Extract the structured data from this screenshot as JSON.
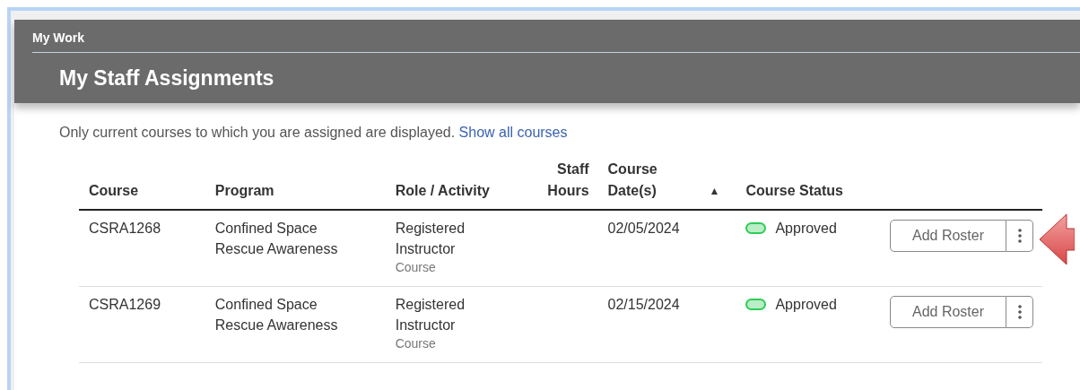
{
  "breadcrumb": "My Work",
  "title": "My Staff Assignments",
  "notice": {
    "text": "Only current courses to which you are assigned are displayed.",
    "link": "Show all courses"
  },
  "table": {
    "columns": [
      {
        "label": "Course"
      },
      {
        "label": "Program"
      },
      {
        "label": "Role / Activity"
      },
      {
        "label": "Staff Hours"
      },
      {
        "label": "Course Date(s)",
        "sort": "▲"
      },
      {
        "label": "Course Status"
      }
    ],
    "rows": [
      {
        "course": "CSRA1268",
        "program": "Confined Space Rescue Awareness",
        "role": "Registered Instructor",
        "activity": "Course",
        "date": "02/05/2024",
        "status": "Approved",
        "color": "#2ecc55",
        "action": "Add Roster",
        "highlighted": true
      },
      {
        "course": "CSRA1269",
        "program": "Confined Space Rescue Awareness",
        "role": "Registered Instructor",
        "activity": "Course",
        "date": "02/15/2024",
        "status": "Approved",
        "color": "#2ecc55",
        "action": "Add Roster",
        "highlighted": false
      }
    ]
  }
}
